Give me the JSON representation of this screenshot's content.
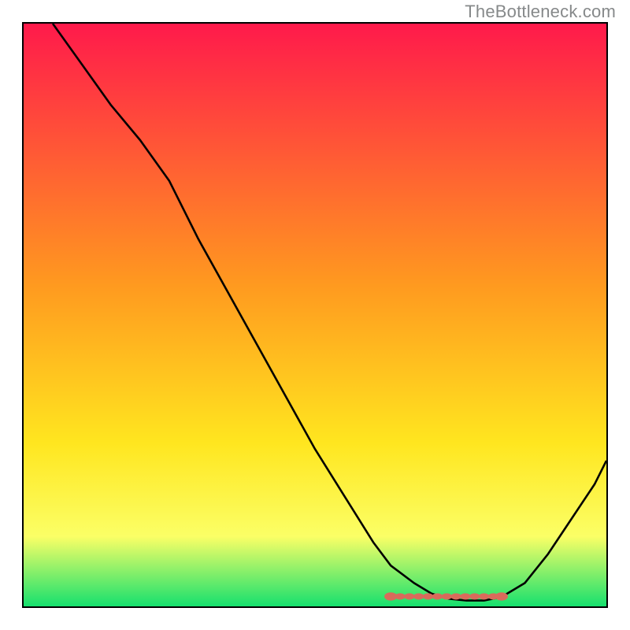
{
  "watermark": "TheBottleneck.com",
  "chart_data": {
    "type": "line",
    "title": "",
    "xlabel": "",
    "ylabel": "",
    "xlim": [
      0,
      100
    ],
    "ylim": [
      0,
      100
    ],
    "series": [
      {
        "name": "curve",
        "x": [
          5,
          10,
          15,
          20,
          25,
          30,
          35,
          40,
          45,
          50,
          55,
          60,
          63,
          67,
          70,
          73,
          76,
          79,
          82,
          86,
          90,
          94,
          98,
          100
        ],
        "y": [
          100,
          93,
          86,
          80,
          73,
          63,
          54,
          45,
          36,
          27,
          19,
          11,
          7,
          4,
          2.2,
          1.3,
          1.0,
          1.0,
          1.6,
          4,
          9,
          15,
          21,
          25
        ]
      }
    ],
    "optimal_band": {
      "x_start": 63,
      "x_end": 82,
      "y": 1.7
    },
    "gradient_stops": [
      {
        "pct": 0,
        "color": "#ff1a4b"
      },
      {
        "pct": 45,
        "color": "#ff9a1f"
      },
      {
        "pct": 72,
        "color": "#ffe61f"
      },
      {
        "pct": 88,
        "color": "#fbff66"
      },
      {
        "pct": 100,
        "color": "#16e06e"
      }
    ]
  }
}
